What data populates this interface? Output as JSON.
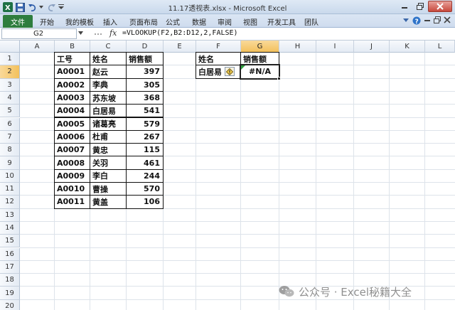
{
  "window": {
    "title": "11.17透视表.xlsx - Microsoft Excel"
  },
  "ribbon": {
    "file_tab": "文件",
    "tabs": [
      "开始",
      "我的模板",
      "插入",
      "页面布局",
      "公式",
      "数据",
      "审阅",
      "视图",
      "开发工具",
      "团队"
    ]
  },
  "formula_bar": {
    "name_box": "G2",
    "fx_label": "fx",
    "formula": "=VLOOKUP(F2,B2:D12,2,FALSE)"
  },
  "sheet": {
    "columns": [
      "A",
      "B",
      "C",
      "D",
      "E",
      "F",
      "G",
      "H",
      "I",
      "J",
      "K",
      "L"
    ],
    "rows": [
      "1",
      "2",
      "3",
      "4",
      "5",
      "6",
      "7",
      "8",
      "9",
      "10",
      "11",
      "12",
      "13",
      "14",
      "15",
      "16",
      "17",
      "18",
      "19",
      "20"
    ],
    "active_column": "G",
    "active_row": "2",
    "table": {
      "headers": [
        "工号",
        "姓名",
        "销售额"
      ],
      "rows": [
        [
          "A0001",
          "赵云",
          "397"
        ],
        [
          "A0002",
          "李典",
          "305"
        ],
        [
          "A0003",
          "苏东坡",
          "368"
        ],
        [
          "A0004",
          "白居易",
          "541"
        ],
        [
          "A0005",
          "诸葛亮",
          "579"
        ],
        [
          "A0006",
          "杜甫",
          "267"
        ],
        [
          "A0007",
          "黄忠",
          "115"
        ],
        [
          "A0008",
          "关羽",
          "461"
        ],
        [
          "A0009",
          "李白",
          "244"
        ],
        [
          "A0010",
          "曹操",
          "570"
        ],
        [
          "A0011",
          "黄盖",
          "106"
        ]
      ]
    },
    "lookup": {
      "header_name": "姓名",
      "header_sales": "销售额",
      "name_value": "白居易",
      "result_value": "#N/A"
    }
  },
  "watermark": {
    "text": "公众号 · Excel秘籍大全"
  },
  "colors": {
    "file_tab": "#2e7d3e",
    "active_header": "#f3c15c",
    "error_flag": "#2e9e3e"
  }
}
